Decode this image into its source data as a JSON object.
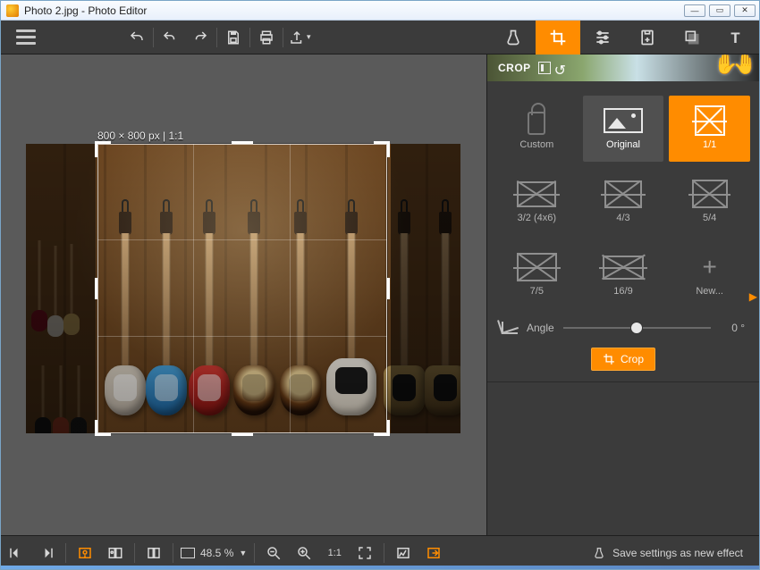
{
  "window": {
    "title": "Photo 2.jpg - Photo Editor"
  },
  "panel": {
    "title": "CROP",
    "angle_label": "Angle",
    "angle_value": "0 °",
    "crop_button": "Crop"
  },
  "crop": {
    "info": "800 × 800 px | 1:1",
    "tiles": [
      {
        "key": "custom",
        "label": "Custom",
        "state": ""
      },
      {
        "key": "original",
        "label": "Original",
        "state": "selected"
      },
      {
        "key": "1_1",
        "label": "1/1",
        "state": "active"
      },
      {
        "key": "3_2",
        "label": "3/2 (4x6)",
        "state": ""
      },
      {
        "key": "4_3",
        "label": "4/3",
        "state": ""
      },
      {
        "key": "5_4",
        "label": "5/4",
        "state": ""
      },
      {
        "key": "7_5",
        "label": "7/5",
        "state": ""
      },
      {
        "key": "16_9",
        "label": "16/9",
        "state": ""
      },
      {
        "key": "new",
        "label": "New...",
        "state": ""
      }
    ]
  },
  "zoom": {
    "value": "48.5 %"
  },
  "bottom": {
    "save_effect": "Save settings as new effect"
  },
  "colors": {
    "accent": "#ff8c00"
  }
}
